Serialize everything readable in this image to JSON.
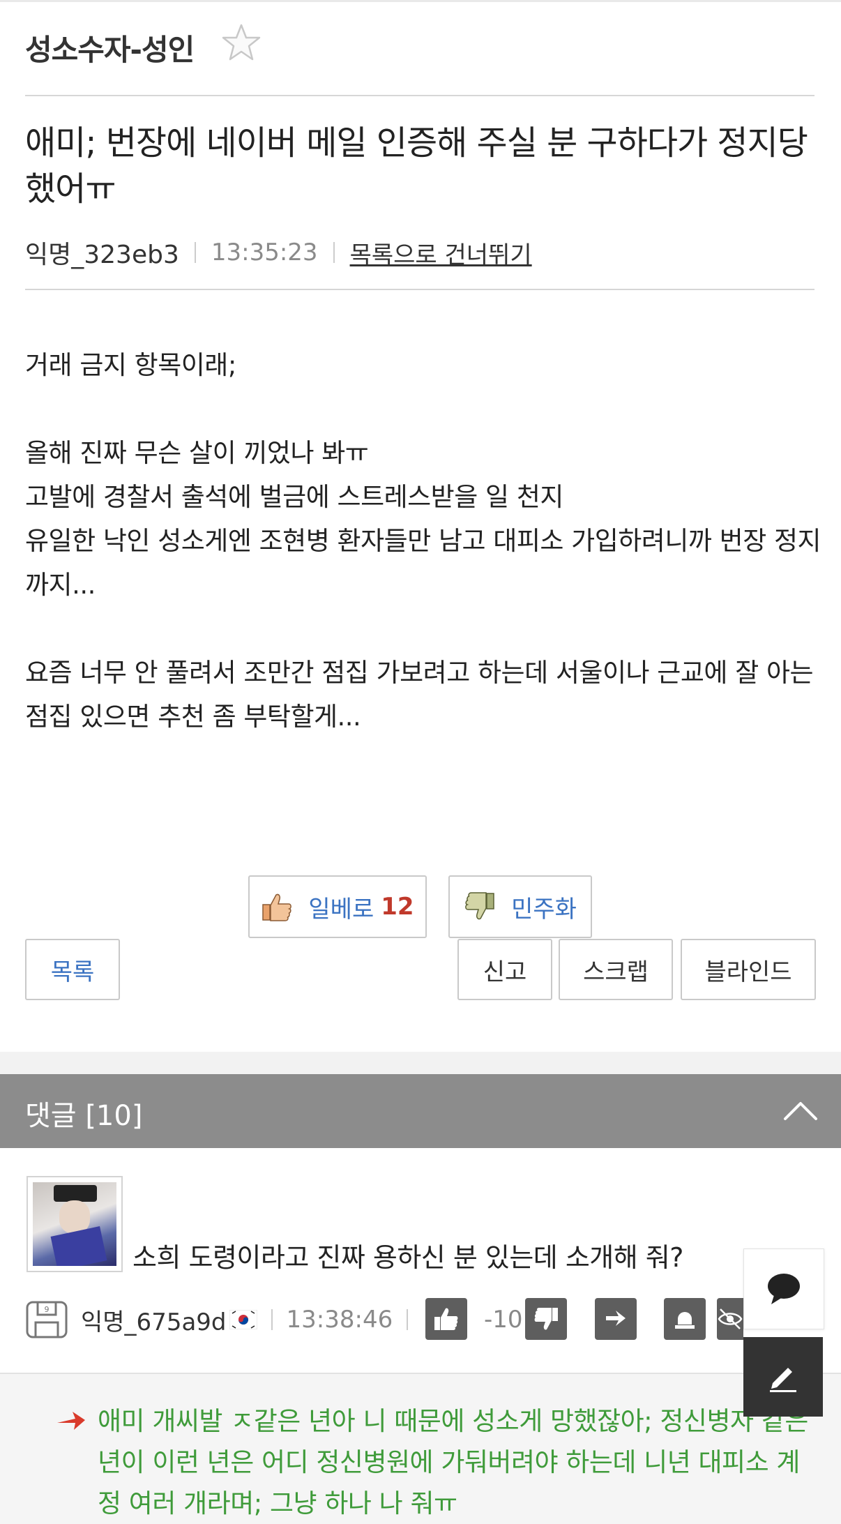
{
  "board": {
    "title": "성소수자-성인",
    "favorite_icon": "star-outline-icon"
  },
  "post": {
    "title": "애미; 번장에 네이버 메일 인증해 주실 분 구하다가 정지당했어ㅠ",
    "author": "익명_323eb3",
    "time": "13:35:23",
    "skip_link": "목록으로 건너뛰기",
    "body": "거래 금지 항목이래;\n\n올해 진짜 무슨 살이 끼었나 봐ㅠ\n고발에 경찰서 출석에 벌금에 스트레스받을 일 천지\n유일한 낙인 성소게엔 조현병 환자들만 남고 대피소 가입하려니까 번장 정지까지...\n\n요즘 너무 안 풀려서 조만간 점집 가보려고 하는데 서울이나 근교에 잘 아는 점집 있으면 추천 좀 부탁할게..."
  },
  "votes": {
    "up_label": "일베로",
    "up_count": "12",
    "up_icon": "thumbs-up-icon",
    "down_label": "민주화",
    "down_icon": "thumbs-down-icon"
  },
  "actions": {
    "list": "목록",
    "report": "신고",
    "scrap": "스크랩",
    "blind": "블라인드"
  },
  "comments": {
    "header": "댓글 [10]",
    "items": [
      {
        "text": "소희 도령이라고 진짜 용하신 분 있는데 소개해 줘?",
        "author": "익명_675a9d",
        "flag": "korea-flag-icon",
        "time": "13:38:46",
        "score": "-10"
      }
    ],
    "reply": {
      "text": "애미 개씨발 ㅈ같은 년아 니 때문에 성소게 망했잖아; 정신병자 같은 년이 이런 년은 어디 정신병원에 가둬버려야 하는데 니년 대피소 계정 여러 개라며; 그냥 하나 나 줘ㅠ"
    }
  },
  "colors": {
    "reply_text": "#3f9b3a",
    "vote_blue": "#3b73c2",
    "count_red": "#c0392b",
    "comment_bar": "#8c8c8c"
  }
}
